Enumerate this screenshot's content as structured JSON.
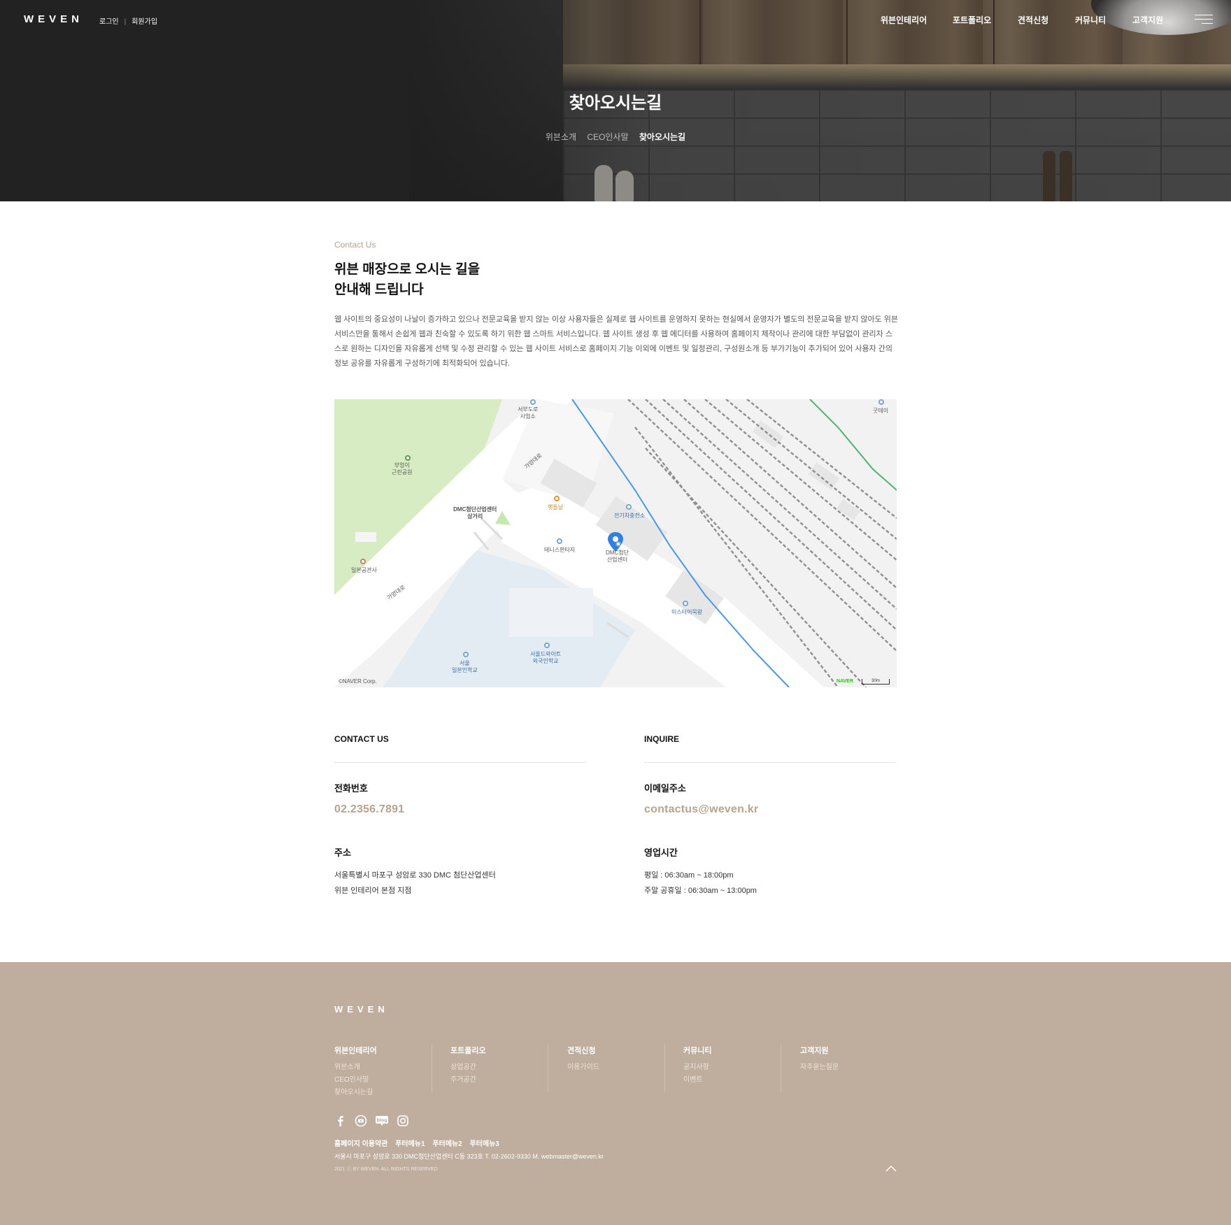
{
  "header": {
    "logo": "WEVEN",
    "login": "로그인",
    "separator": "|",
    "signup": "회원가입",
    "nav": [
      "위븐인테리어",
      "포트폴리오",
      "견적신청",
      "커뮤니티",
      "고객지원"
    ],
    "menu_icon": "hamburger-icon"
  },
  "hero": {
    "title": "찾아오시는길",
    "breadcrumb": [
      "위븐소개",
      "CEO인사말",
      "찾아오시는길"
    ]
  },
  "content": {
    "label": "Contact Us",
    "heading_line1": "위븐 매장으로 오시는 길을",
    "heading_line2": "안내해 드립니다",
    "description": "웹 사이트의 중요성이 나날이 증가하고 있으나 전문교육을 받지 않는 이상 사용자들은 실제로 웹 사이트를 운영하지 못하는 현실에서 운영자가 별도의 전문교육을 받지 않아도 위븐 서비스만을 통해서 손쉽게 웹과 친숙할 수 있도록 하기 위한 웹 스마트 서비스입니다. 웹 사이트 생성 후 웹 에디터를 사용하여 홈페이지 제작이나 관리에 대한 부담없이 관리자 스스로 원하는 디자인을 자유롭게 선택 및 수정 관리할 수 있는 웹 사이트 서비스로 홈페이지 기능 이외에 이벤트 및 일정관리, 구성원소개 등 부가기능이 추가되어 있어 사용자 간의 정보 공유를 자유롭게 구성하기에 최적화되어 있습니다."
  },
  "map": {
    "labels": {
      "seobu": "서부도로\n사업소",
      "goodday": "굿데이",
      "park": "부엉이\n근린공원",
      "road1": "가양대로",
      "junction": "DMC첨단산업센터\n삼거리",
      "cafe": "햇들날",
      "charging": "전기차충전소",
      "tennis": "테니스판타지",
      "dmc": "DMC첨단\n산업센터",
      "japan_hall": "일본공관사",
      "road2": "가양대로",
      "mister": "미스터어묵왕",
      "seoul_world": "서울드와이트\n외국인학교",
      "seoul_japan": "서울\n일본인학교"
    },
    "copyright": "©NAVER Corp.",
    "provider": "NAVER",
    "scale": "30m"
  },
  "contact": {
    "left_title": "CONTACT US",
    "right_title": "INQUIRE",
    "phone_label": "전화번호",
    "phone": "02.2356.7891",
    "email_label": "이메일주소",
    "email": "contactus@weven.kr",
    "address_label": "주소",
    "address_line1": "서울특별시 마포구 성암로 330 DMC 첨단산업센터",
    "address_line2": "위븐 인테리어 본점 지점",
    "hours_label": "영업시간",
    "hours_weekday": "평일 : 06:30am ~ 18:00pm",
    "hours_weekend": "주말 공휴일 : 06:30am ~ 13:00pm"
  },
  "footer": {
    "logo": "WEVEN",
    "menus": [
      {
        "title": "위븐인테리어",
        "items": [
          "위븐소개",
          "CEO인사말",
          "찾아오시는길"
        ]
      },
      {
        "title": "포트폴리오",
        "items": [
          "상업공간",
          "주거공간"
        ]
      },
      {
        "title": "견적신청",
        "items": [
          "이용가이드"
        ]
      },
      {
        "title": "커뮤니티",
        "items": [
          "공지사항",
          "이벤트"
        ]
      },
      {
        "title": "고객지원",
        "items": [
          "자주묻는질문"
        ]
      }
    ],
    "social": [
      "facebook-icon",
      "youtube-icon",
      "blog-icon",
      "instagram-icon"
    ],
    "blog_text": "blog",
    "links": [
      "홈페이지 이용약관",
      "푸터메뉴1",
      "푸터메뉴2",
      "푸터메뉴3"
    ],
    "address": "서울시 마포구 성암로 330 DMC첨단산업센터 C동 323호   T. 02-2602-9330 M. webmaster@weven.kr",
    "copyright": "2021 ⓒ BY WEVEN. ALL RIGHTS RESERVED"
  },
  "colors": {
    "accent": "#b8a390",
    "footer_bg": "#bfae9e",
    "hero_dark": "#222222"
  }
}
